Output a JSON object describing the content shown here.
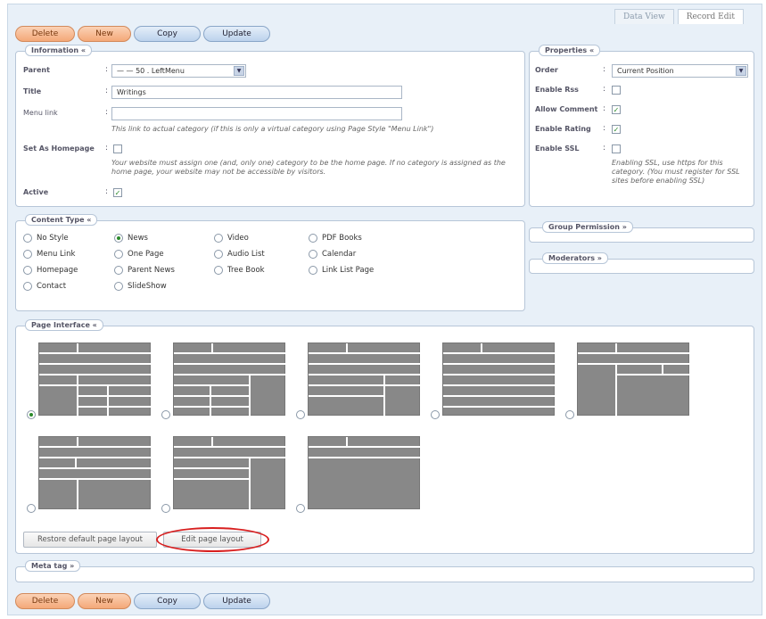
{
  "tabs": {
    "data_view": "Data View",
    "record_edit": "Record Edit"
  },
  "buttons": {
    "delete": "Delete",
    "new": "New",
    "copy": "Copy",
    "update": "Update"
  },
  "information": {
    "legend": "Information «",
    "parent_label": "Parent",
    "parent_value": "— — 50 . LeftMenu",
    "title_label": "Title",
    "title_value": "Writings",
    "menu_link_label": "Menu link",
    "menu_link_value": "",
    "menu_link_note": "This link to actual category (if this is only a virtual category using Page Style \"Menu Link\")",
    "homepage_label": "Set As Homepage",
    "homepage_checked": false,
    "homepage_note": "Your website must assign one (and, only one) category to be the home page. If no category is assigned as the home page, your website may not be accessible by visitors.",
    "active_label": "Active",
    "active_checked": true
  },
  "properties": {
    "legend": "Properties «",
    "order_label": "Order",
    "order_value": "Current Position",
    "enable_rss_label": "Enable Rss",
    "enable_rss_checked": false,
    "allow_comment_label": "Allow Comment",
    "allow_comment_checked": true,
    "enable_rating_label": "Enable Rating",
    "enable_rating_checked": true,
    "enable_ssl_label": "Enable SSL",
    "enable_ssl_checked": false,
    "ssl_note": "Enabling SSL, use https for this category. (You must register for SSL sites before enabling SSL)"
  },
  "content_type": {
    "legend": "Content Type «",
    "options": [
      "No Style",
      "News",
      "Video",
      "PDF Books",
      "Menu Link",
      "One Page",
      "Audio List",
      "Calendar",
      "Homepage",
      "Parent News",
      "Tree Book",
      "Link List Page",
      "Contact",
      "SlideShow"
    ],
    "selected": "News"
  },
  "group_permission": {
    "legend": "Group Permission »"
  },
  "moderators": {
    "legend": "Moderators »"
  },
  "page_interface": {
    "legend": "Page Interface «",
    "selected_layout": 1,
    "restore_label": "Restore default page layout",
    "edit_label": "Edit page layout"
  },
  "meta_tag": {
    "legend": "Meta tag »"
  },
  "colors": {
    "accent_orange": "#f4a878",
    "accent_blue": "#bcd2ec",
    "highlight_red": "#d82020"
  },
  "icons": {
    "select_arrow": "chevron-down-icon",
    "check": "checkmark-icon"
  }
}
